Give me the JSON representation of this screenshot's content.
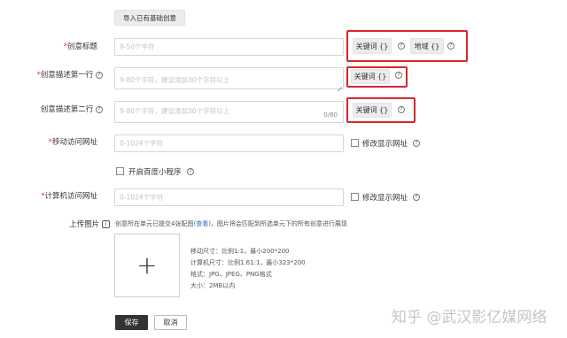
{
  "import_button": "导入已有基础创意",
  "labels": {
    "title": "创意标题",
    "desc1": "创意描述第一行",
    "desc2": "创意描述第二行",
    "mobile_url": "移动访问网址",
    "pc_url": "计算机访问网址",
    "upload_image": "上传图片"
  },
  "required_mark": "*",
  "placeholders": {
    "title": "9-50个字符",
    "desc1": "9-80个字符，建议添加30个字符以上",
    "desc2": "9-80个字符，建议添加30个字符以上",
    "mobile_url": "0-1024个字符",
    "pc_url": "0-1024个字符"
  },
  "desc2_counter": "0/80",
  "insert_buttons": {
    "keyword": "关键词 {}",
    "region": "地域 {}"
  },
  "checkboxes": {
    "modify_display_url": "修改显示网址",
    "baidu_mini_program": "开启百度小程序"
  },
  "upload": {
    "note_before": "创意所在单元已提交4张配图",
    "view_link": "(查看)",
    "note_after": "，图片将会匹配到所选单元下的所有创意进行展现",
    "plus": "+",
    "specs": [
      "移动尺寸：比例1:1，最小200*200",
      "计算机尺寸：比例1.61:1，最小323*200",
      "格式：JPG、JPEG、PNG格式",
      "大小：2MB以内"
    ]
  },
  "actions": {
    "save": "保存",
    "cancel": "取消"
  },
  "watermark": "知乎 @武汉影亿媒网络",
  "icons": {
    "help": "help-circle-icon",
    "upload_info": "image-info-icon",
    "plus": "plus-icon"
  },
  "colors": {
    "highlight_border": "#d9262c",
    "required": "#e23b3b",
    "save_bg": "#333333",
    "link": "#2d6cc8"
  }
}
